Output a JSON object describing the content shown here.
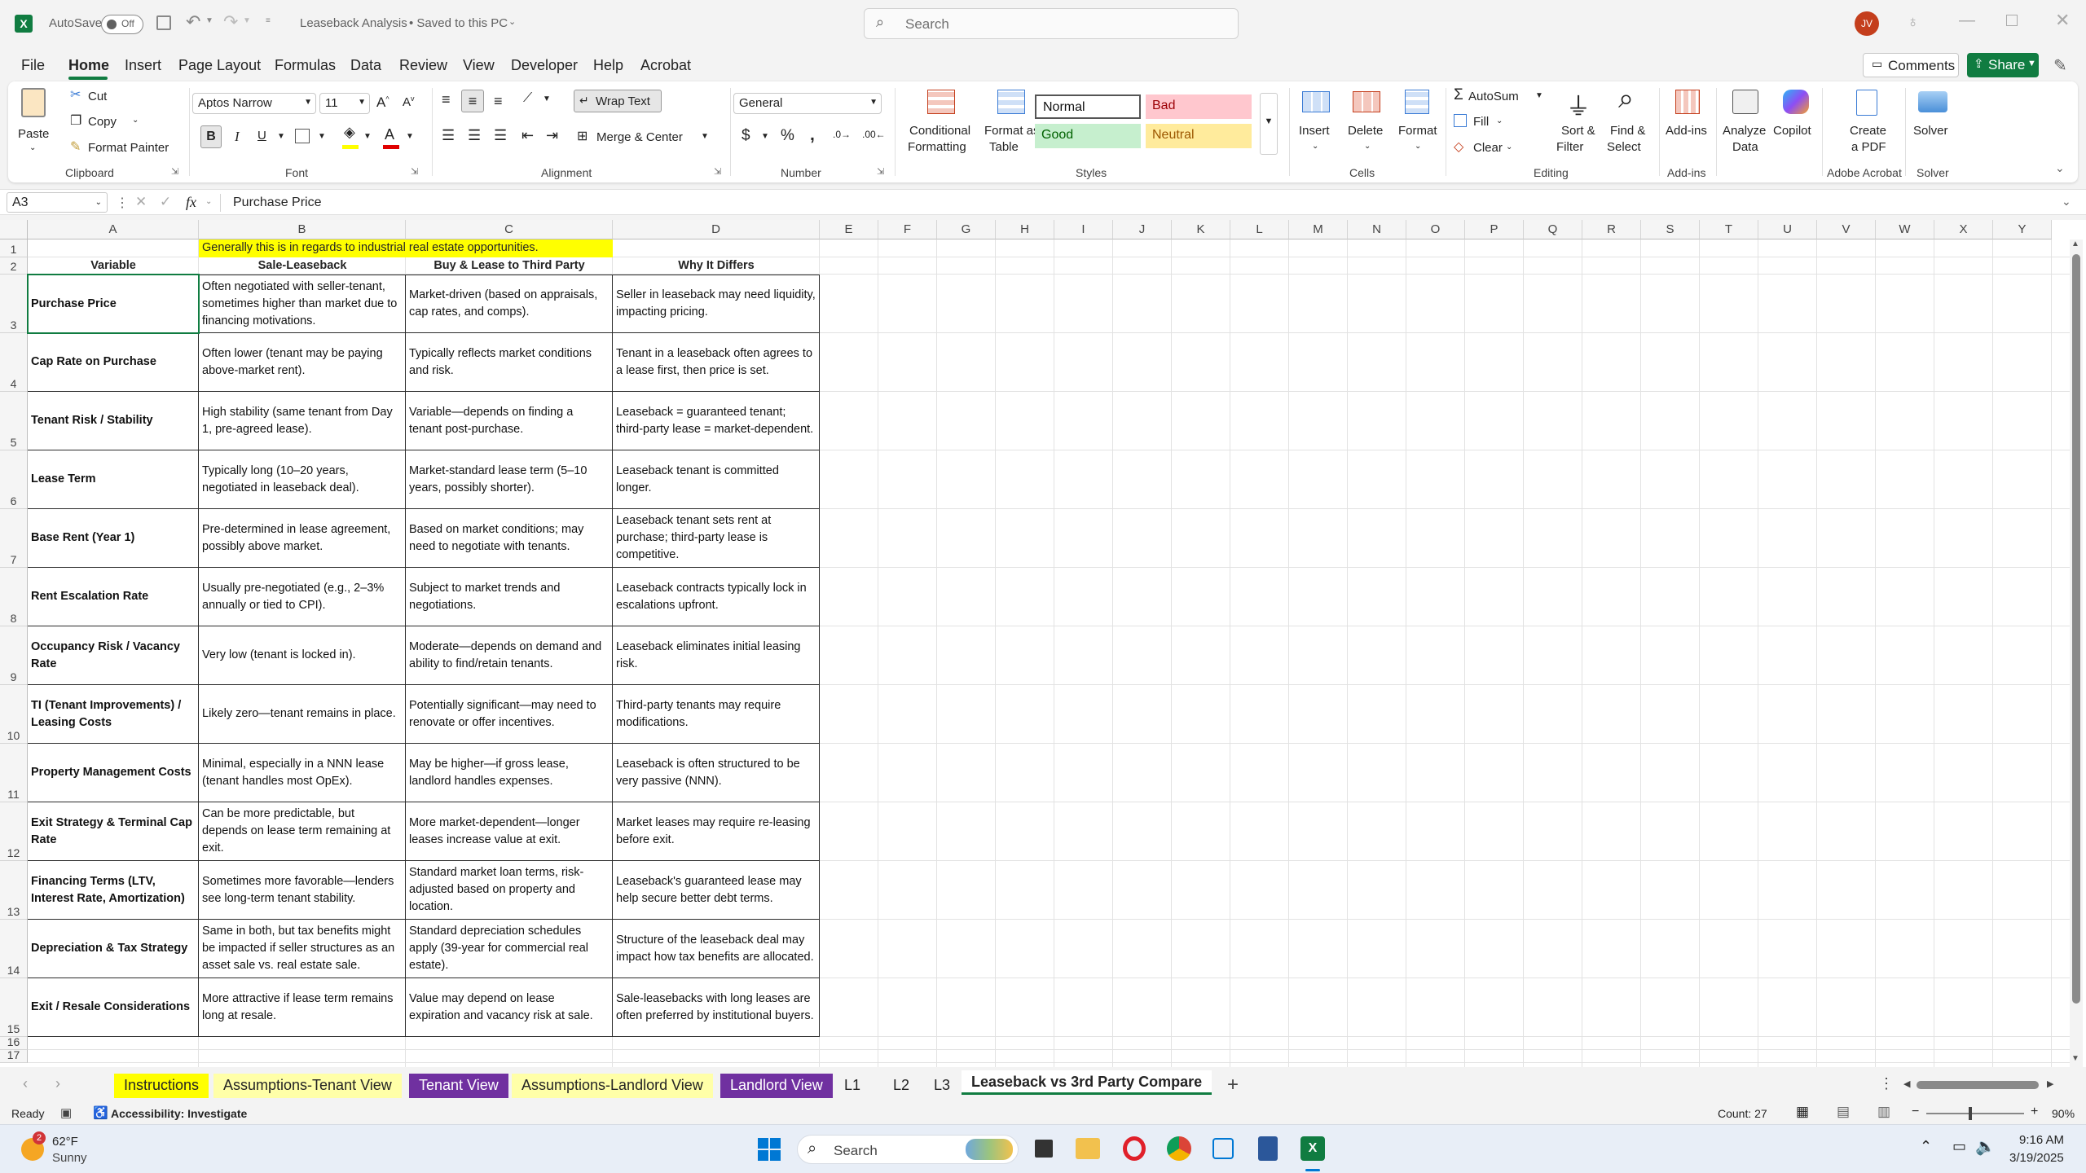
{
  "titlebar": {
    "autosave_label": "AutoSave",
    "autosave_state": "Off",
    "doc_title": "Leaseback Analysis",
    "save_status": "• Saved to this PC",
    "search_placeholder": "Search",
    "avatar_initials": "JV"
  },
  "menu": [
    "File",
    "Home",
    "Insert",
    "Page Layout",
    "Formulas",
    "Data",
    "Review",
    "View",
    "Developer",
    "Help",
    "Acrobat"
  ],
  "header_buttons": {
    "comments": "Comments",
    "share": "Share"
  },
  "ribbon": {
    "clipboard": {
      "label": "Clipboard",
      "paste": "Paste",
      "cut": "Cut",
      "copy": "Copy",
      "format_painter": "Format Painter"
    },
    "font": {
      "label": "Font",
      "font_name": "Aptos Narrow",
      "font_size": "11"
    },
    "alignment": {
      "label": "Alignment",
      "wrap_text": "Wrap Text",
      "merge_center": "Merge & Center"
    },
    "number": {
      "label": "Number",
      "format": "General"
    },
    "styles": {
      "label": "Styles",
      "conditional_1": "Conditional",
      "conditional_2": "Formatting",
      "format_table_1": "Format as",
      "format_table_2": "Table",
      "normal": "Normal",
      "bad": "Bad",
      "good": "Good",
      "neutral": "Neutral"
    },
    "cells": {
      "label": "Cells",
      "insert": "Insert",
      "delete": "Delete",
      "format": "Format"
    },
    "editing": {
      "label": "Editing",
      "autosum": "AutoSum",
      "fill": "Fill",
      "clear": "Clear",
      "sort_1": "Sort &",
      "sort_2": "Filter",
      "find_1": "Find &",
      "find_2": "Select"
    },
    "addins": {
      "label": "Add-ins",
      "addins": "Add-ins",
      "analyze_1": "Analyze",
      "analyze_2": "Data",
      "copilot": "Copilot"
    },
    "acrobat": {
      "label": "Adobe Acrobat",
      "create_1": "Create",
      "create_2": "a PDF"
    },
    "solver": {
      "label": "Solver",
      "solver": "Solver"
    }
  },
  "formula_bar": {
    "name_box": "A3",
    "fx": "fx",
    "content": "Purchase Price"
  },
  "columns": [
    "A",
    "B",
    "C",
    "D",
    "E",
    "F",
    "G",
    "H",
    "I",
    "J",
    "K",
    "L",
    "M",
    "N",
    "O",
    "P",
    "Q",
    "R",
    "S",
    "T",
    "U",
    "V",
    "W",
    "X",
    "Y"
  ],
  "sheet": {
    "note": "Generally this is in regards to industrial real estate opportunities.",
    "headers": [
      "Variable",
      "Sale-Leaseback",
      "Buy & Lease to Third Party",
      "Why It Differs"
    ],
    "rows": [
      [
        "Purchase Price",
        "Often negotiated with seller-tenant, sometimes higher than market due to financing motivations.",
        "Market-driven (based on appraisals, cap rates, and comps).",
        "Seller in leaseback may need liquidity, impacting pricing."
      ],
      [
        "Cap Rate on Purchase",
        "Often lower (tenant may be paying above-market rent).",
        "Typically reflects market conditions and risk.",
        "Tenant in a leaseback often agrees to a lease first, then price is set."
      ],
      [
        "Tenant Risk / Stability",
        "High stability (same tenant from Day 1, pre-agreed lease).",
        "Variable—depends on finding a tenant post-purchase.",
        "Leaseback = guaranteed tenant; third-party lease = market-dependent."
      ],
      [
        "Lease Term",
        "Typically long (10–20 years, negotiated in leaseback deal).",
        "Market-standard lease term (5–10 years, possibly shorter).",
        "Leaseback tenant is committed longer."
      ],
      [
        "Base Rent (Year 1)",
        "Pre-determined in lease agreement, possibly above market.",
        "Based on market conditions; may need to negotiate with tenants.",
        "Leaseback tenant sets rent at purchase; third-party lease is competitive."
      ],
      [
        "Rent Escalation Rate",
        "Usually pre-negotiated (e.g., 2–3% annually or tied to CPI).",
        "Subject to market trends and negotiations.",
        "Leaseback contracts typically lock in escalations upfront."
      ],
      [
        "Occupancy Risk / Vacancy Rate",
        "Very low (tenant is locked in).",
        "Moderate—depends on demand and ability to find/retain tenants.",
        "Leaseback eliminates initial leasing risk."
      ],
      [
        "TI (Tenant Improvements) / Leasing Costs",
        "Likely zero—tenant remains in place.",
        "Potentially significant—may need to renovate or offer incentives.",
        "Third-party tenants may require modifications."
      ],
      [
        "Property Management Costs",
        "Minimal, especially in a NNN lease (tenant handles most OpEx).",
        "May be higher—if gross lease, landlord handles expenses.",
        "Leaseback is often structured to be very passive (NNN)."
      ],
      [
        "Exit Strategy & Terminal Cap Rate",
        "Can be more predictable, but depends on lease term remaining at exit.",
        "More market-dependent—longer leases increase value at exit.",
        "Market leases may require re-leasing before exit."
      ],
      [
        "Financing Terms (LTV, Interest Rate, Amortization)",
        "Sometimes more favorable—lenders see long-term tenant stability.",
        "Standard market loan terms, risk-adjusted based on property and location.",
        "Leaseback's guaranteed lease may help secure better debt terms."
      ],
      [
        "Depreciation & Tax Strategy",
        "Same in both, but tax benefits might be impacted if seller structures as an asset sale vs. real estate sale.",
        "Standard depreciation schedules apply (39-year for commercial real estate).",
        "Structure of the leaseback deal may impact how tax benefits are allocated."
      ],
      [
        "Exit / Resale Considerations",
        "More attractive if lease term remains long at resale.",
        "Value may depend on lease expiration and vacancy risk at sale.",
        "Sale-leasebacks with long leases are often preferred by institutional buyers."
      ]
    ]
  },
  "row_numbers": [
    "1",
    "2",
    "3",
    "4",
    "5",
    "6",
    "7",
    "8",
    "9",
    "10",
    "11",
    "12",
    "13",
    "14",
    "15",
    "16",
    "17"
  ],
  "tabs": [
    {
      "label": "Instructions",
      "bg": "#ffff00",
      "color": "#242424"
    },
    {
      "label": "Assumptions-Tenant View",
      "bg": "#ffffa8",
      "color": "#242424"
    },
    {
      "label": "Tenant View",
      "bg": "#7030a0",
      "color": "#ffffff"
    },
    {
      "label": "Assumptions-Landlord View",
      "bg": "#ffffa8",
      "color": "#242424"
    },
    {
      "label": "Landlord View",
      "bg": "#7030a0",
      "color": "#ffffff"
    },
    {
      "label": "L1",
      "bg": "",
      "color": "#242424"
    },
    {
      "label": "L2",
      "bg": "",
      "color": "#242424"
    },
    {
      "label": "L3",
      "bg": "",
      "color": "#242424"
    },
    {
      "label": "Leaseback vs 3rd Party Compare",
      "bg": "#ffffff",
      "color": "#107c41"
    }
  ],
  "status": {
    "ready": "Ready",
    "accessibility": "Accessibility: Investigate",
    "count": "Count: 27",
    "zoom": "90%"
  },
  "taskbar": {
    "temp": "62°F",
    "weather": "Sunny",
    "search": "Search",
    "time": "9:16 AM",
    "date": "3/19/2025",
    "weather_badge": "2"
  },
  "colors": {
    "excel_green": "#107c41",
    "highlight_yellow": "#ffff00",
    "purple_tab": "#7030a0"
  }
}
